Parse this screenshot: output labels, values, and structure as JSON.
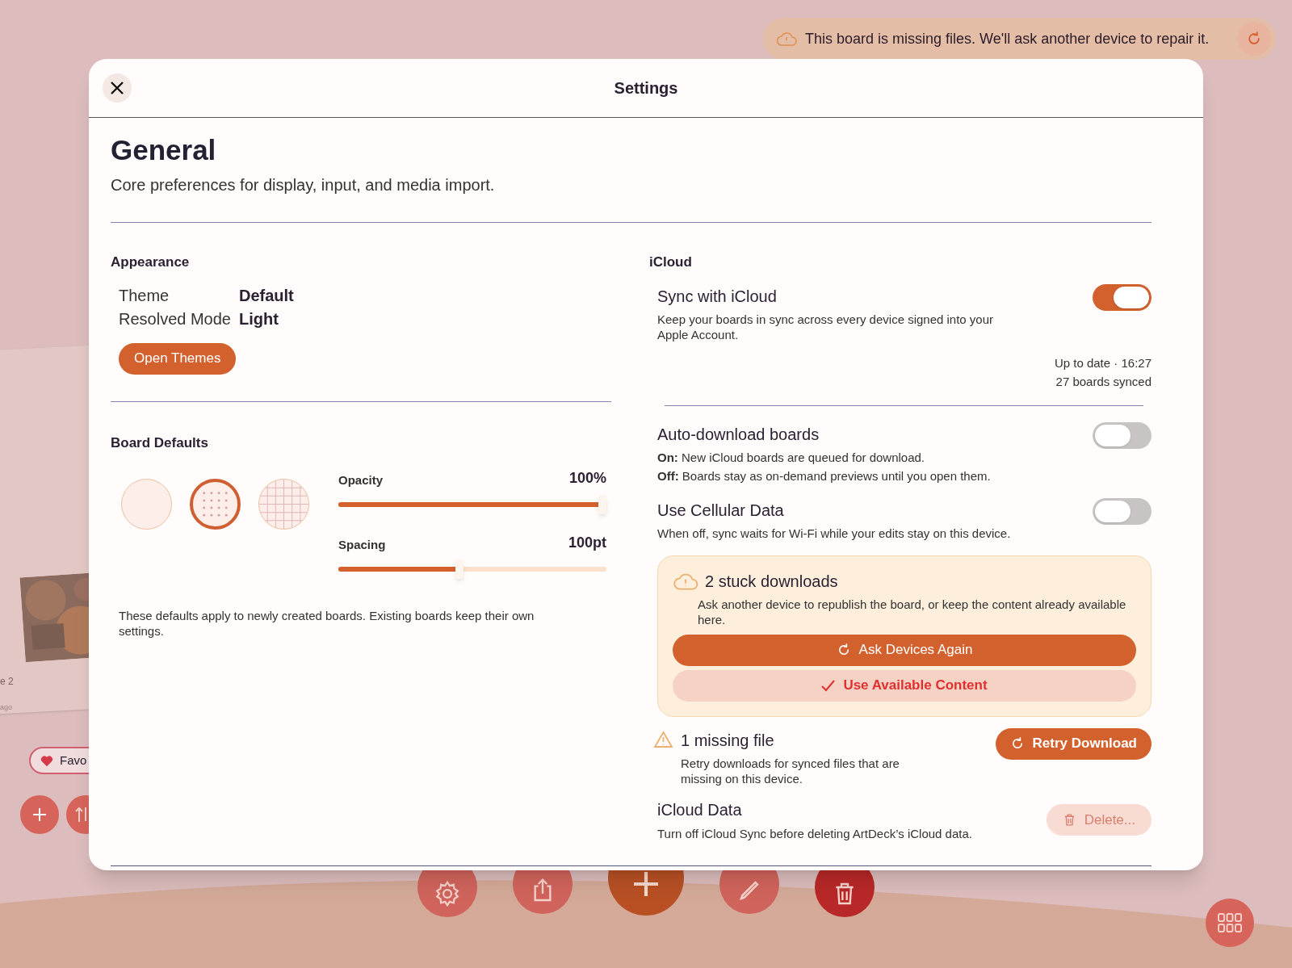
{
  "banner": {
    "message": "This board is missing files. We'll ask another device to repair it."
  },
  "background": {
    "fragments": [
      "e 2",
      "ago"
    ],
    "favorites_chip": "Favo"
  },
  "modal": {
    "title": "Settings"
  },
  "page": {
    "title": "General",
    "subtitle": "Core preferences for display, input, and media import."
  },
  "appearance": {
    "heading": "Appearance",
    "rows": [
      {
        "label": "Theme",
        "value": "Default"
      },
      {
        "label": "Resolved Mode",
        "value": "Light"
      }
    ],
    "button": "Open Themes"
  },
  "board_defaults": {
    "heading": "Board Defaults",
    "patterns": [
      {
        "kind": "plain",
        "selected": false
      },
      {
        "kind": "dots",
        "selected": true
      },
      {
        "kind": "grid",
        "selected": false
      }
    ],
    "sliders": [
      {
        "label": "Opacity",
        "reading": "100%",
        "level": 1
      },
      {
        "label": "Spacing",
        "reading": "100pt",
        "level": 0.45
      }
    ],
    "note": "These defaults apply to newly created boards. Existing boards keep their own settings."
  },
  "icloud": {
    "heading": "iCloud",
    "sync": {
      "title": "Sync with iCloud",
      "description": "Keep your boards in sync across every device signed into your Apple Account.",
      "on": true,
      "status": [
        "Up to date · 16:27",
        "27 boards synced"
      ]
    },
    "toggles": [
      {
        "title": "Auto-download boards",
        "lines": [
          "**On:** New iCloud boards are queued for download.",
          "**Off:** Boards stay as on-demand previews until you open them."
        ],
        "on": false
      },
      {
        "title": "Use Cellular Data",
        "lines": [
          "When off, sync waits for Wi-Fi while your edits stay on this device."
        ],
        "on": false
      }
    ],
    "stuck": {
      "title": "2 stuck downloads",
      "description": "Ask another device to republish the board, or keep the content already available here.",
      "primary": "Ask Devices Again",
      "secondary": "Use Available Content"
    },
    "missing": {
      "title": "1 missing file",
      "description": "Retry downloads for synced files that are missing on this device.",
      "button": "Retry Download"
    },
    "data": {
      "title": "iCloud Data",
      "description": "Turn off iCloud Sync before deleting ArtDeck’s iCloud data.",
      "button": "Delete...",
      "disabled": true
    }
  }
}
